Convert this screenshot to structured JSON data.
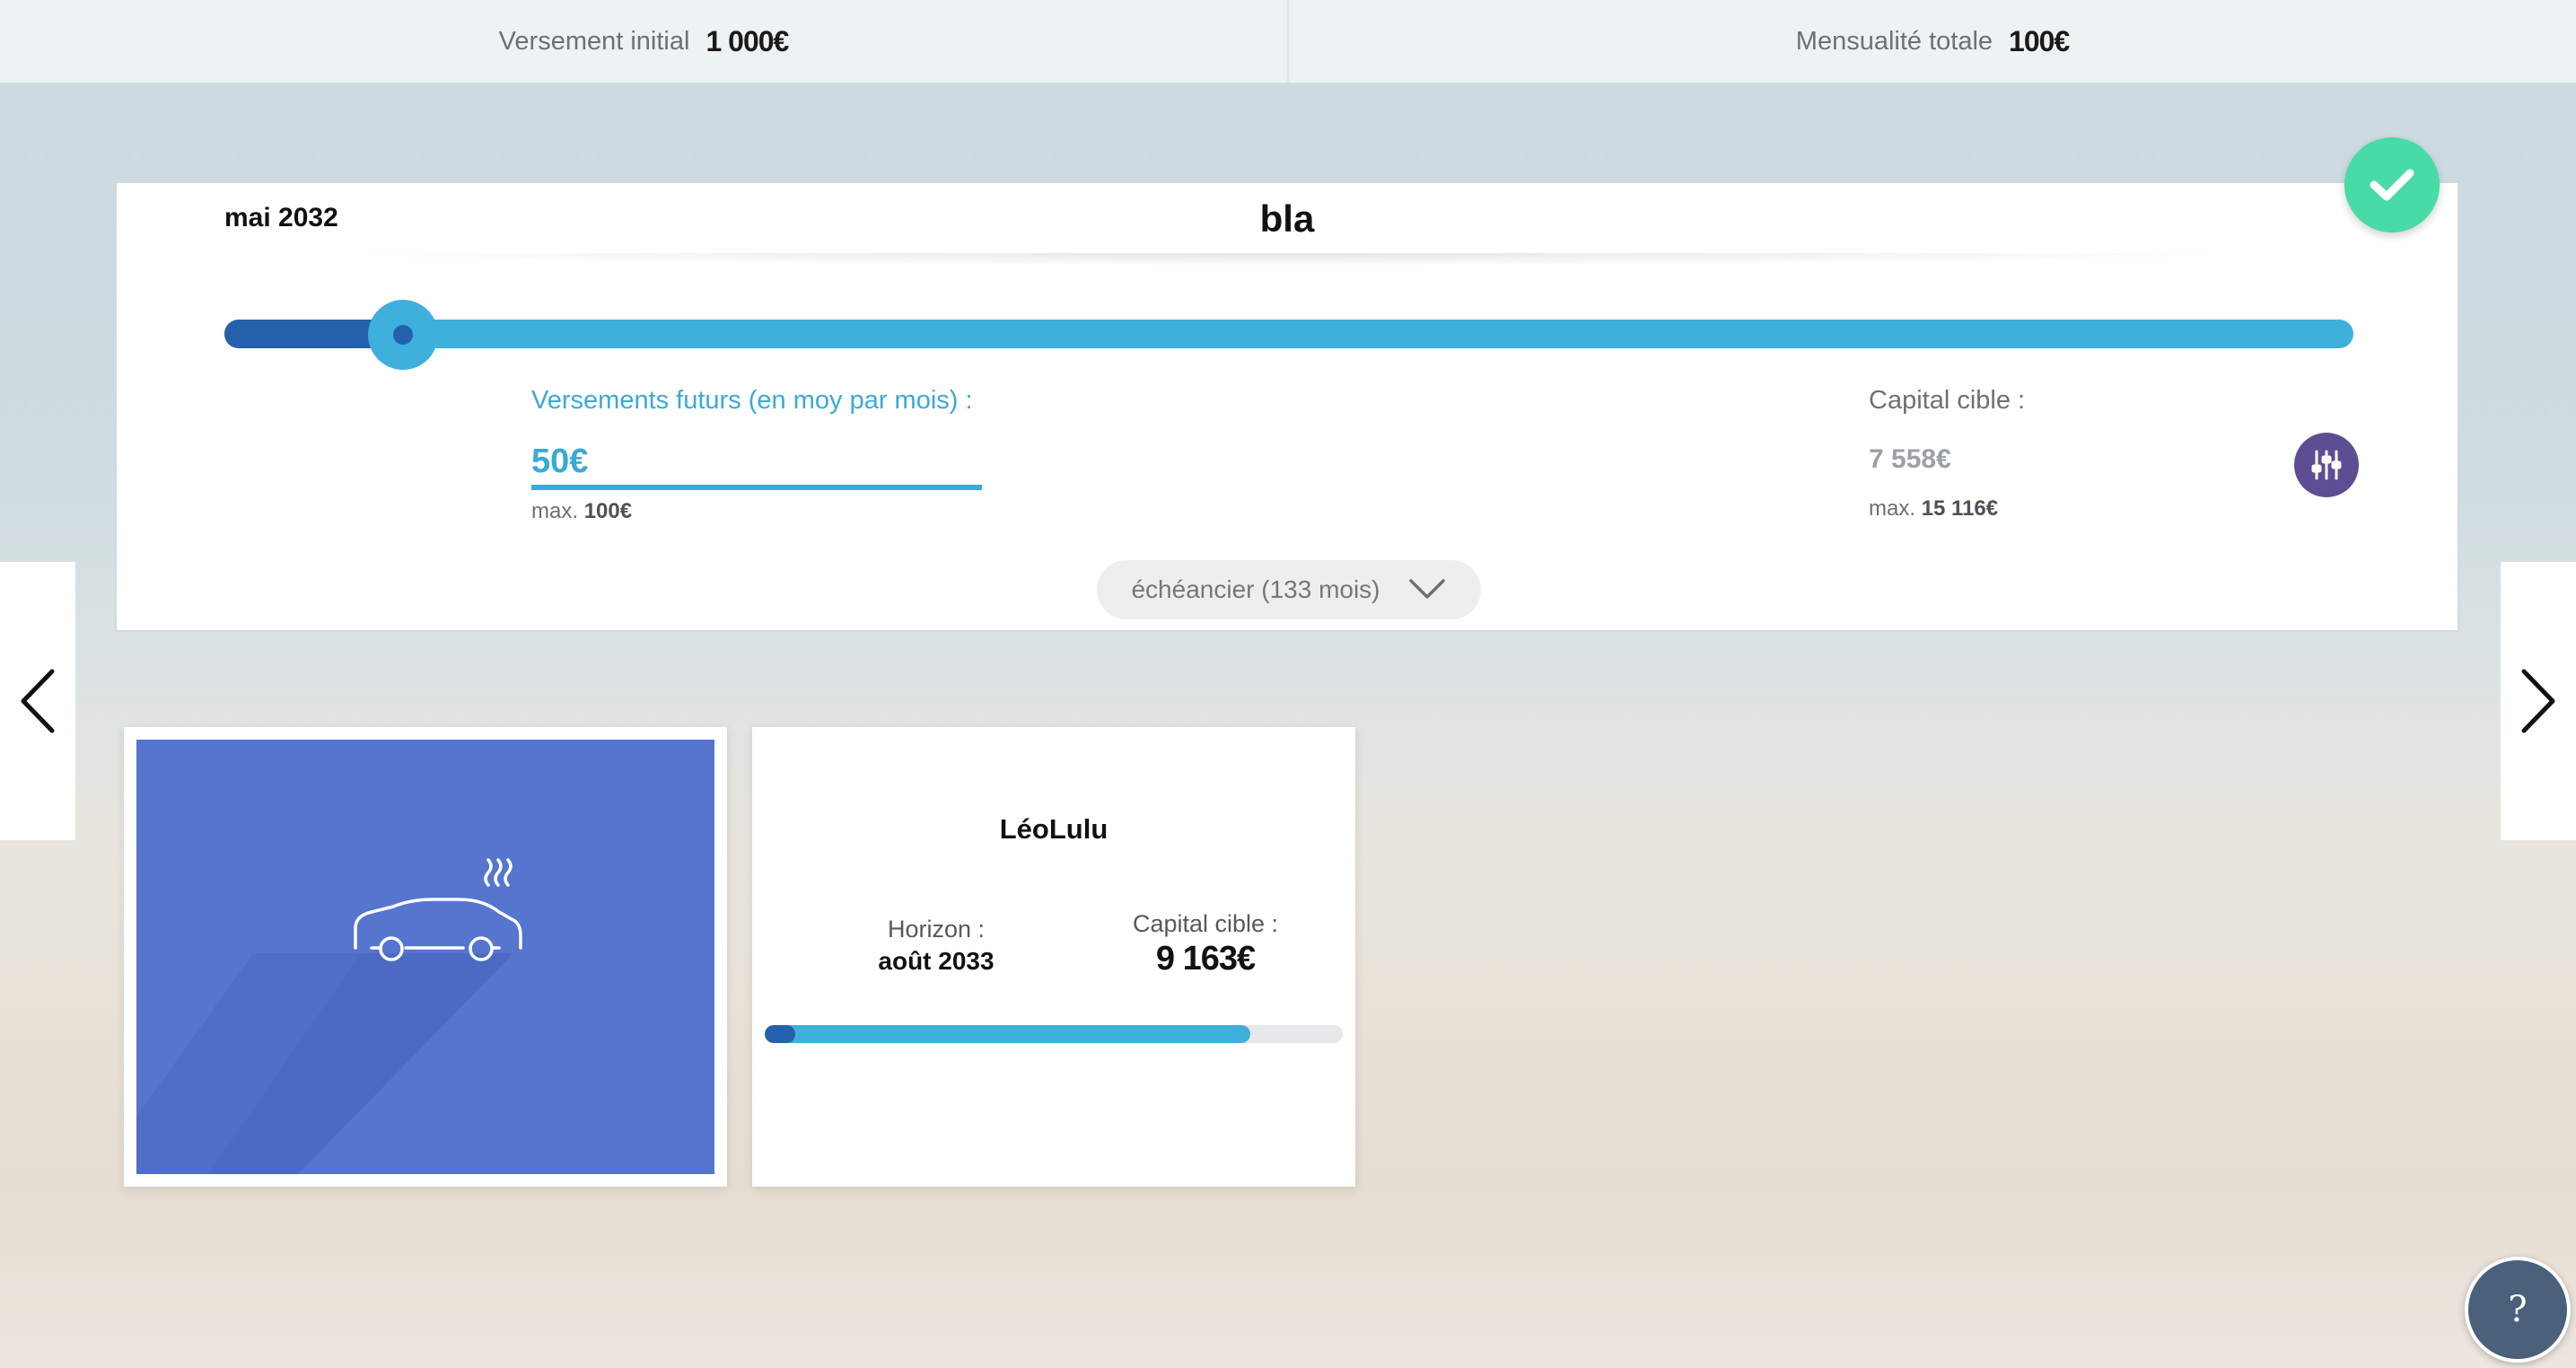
{
  "topbar": {
    "initial_label": "Versement initial",
    "initial_value": "1 000€",
    "monthly_label": "Mensualité totale",
    "monthly_value": "100€"
  },
  "goal": {
    "date": "mai 2032",
    "name": "bla",
    "slider_fraction": 0.085,
    "future_payments": {
      "label": "Versements futurs (en moy par mois) :",
      "value": "50€",
      "max_prefix": "max.",
      "max_value": "100€"
    },
    "target_capital": {
      "label": "Capital cible :",
      "value": "7 558€",
      "max_prefix": "max.",
      "max_value": "15 116€"
    },
    "schedule_label": "échéancier (133 mois)"
  },
  "cards": {
    "image_icon": "car-smoke-icon",
    "info": {
      "name": "LéoLulu",
      "horizon_label": "Horizon :",
      "horizon_value": "août 2033",
      "target_label": "Capital cible :",
      "target_value": "9 163€",
      "progress_fraction": 0.84
    }
  },
  "help": {
    "label": "?"
  },
  "colors": {
    "accent": "#3fb0db",
    "dark_accent": "#2560ac",
    "success": "#48dba6",
    "settings": "#5d4e94",
    "card_blue": "#5575cf"
  }
}
